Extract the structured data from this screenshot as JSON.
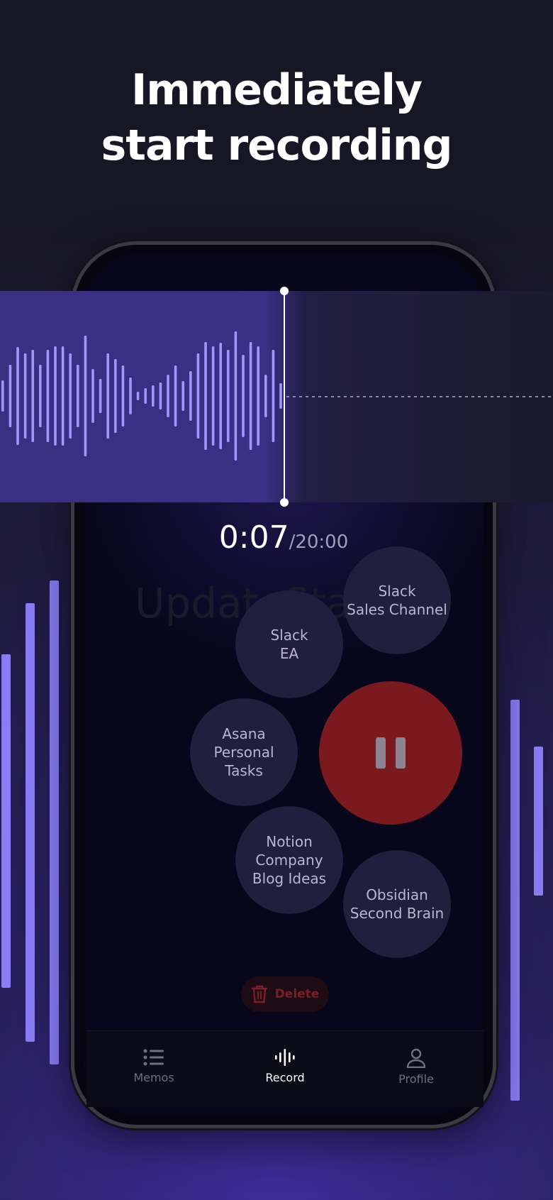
{
  "headline": {
    "line1": "Immediately",
    "line2": "start recording"
  },
  "timer": {
    "elapsed": "0:07",
    "total": "/20:00"
  },
  "ghost_text": "UpdateStar...",
  "destinations": [
    {
      "id": "slack-sales",
      "label": "Slack\nSales Channel"
    },
    {
      "id": "slack-ea",
      "label": "Slack\nEA"
    },
    {
      "id": "asana",
      "label": "Asana\nPersonal\nTasks"
    },
    {
      "id": "notion",
      "label": "Notion\nCompany\nBlog Ideas"
    },
    {
      "id": "obsidian",
      "label": "Obsidian\nSecond Brain"
    }
  ],
  "controls": {
    "pause_icon": "pause-icon",
    "delete_label": "Delete"
  },
  "tabs": [
    {
      "label": "Memos",
      "icon": "list-icon",
      "active": false
    },
    {
      "label": "Record",
      "icon": "waveform-icon",
      "active": true
    },
    {
      "label": "Profile",
      "icon": "user-icon",
      "active": false
    }
  ],
  "colors": {
    "accent": "#8a7cf5",
    "record_button": "#7a1a1e",
    "bubble": "#221e3e",
    "delete_text": "#7a1e28"
  }
}
